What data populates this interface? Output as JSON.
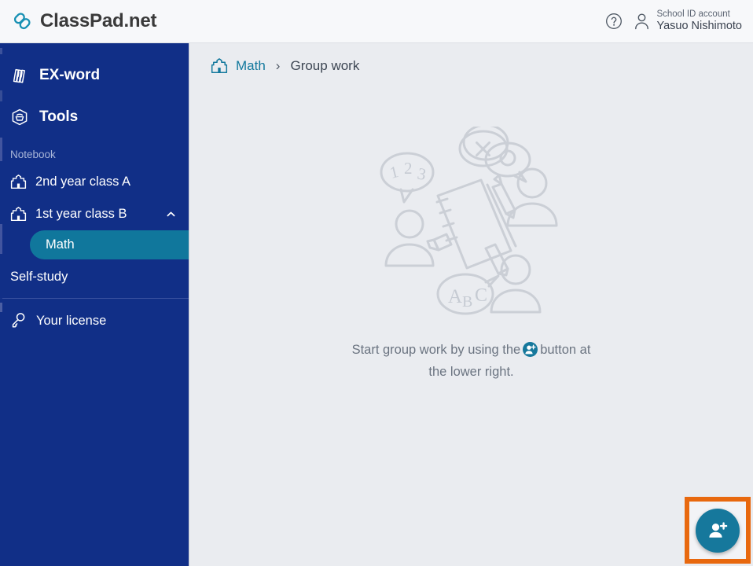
{
  "app": {
    "brand_name": "ClassPad.net",
    "logo_icon": "chain-link-icon",
    "accent_teal": "#16789c",
    "sidebar_navy": "#112f87",
    "annotation_orange": "#e8680e",
    "main_bg": "#eaecf0"
  },
  "topbar": {
    "help_icon": "question-circle-icon",
    "user_icon": "person-icon",
    "account_type": "School ID account",
    "account_name": "Yasuo Nishimoto"
  },
  "sidebar": {
    "top_items": [
      {
        "label": "EX-word",
        "icon": "books-icon"
      },
      {
        "label": "Tools",
        "icon": "toolbox-icon"
      }
    ],
    "section_label": "Notebook",
    "notebooks": [
      {
        "label": "2nd year class A",
        "icon": "classroom-icon",
        "expanded": false
      },
      {
        "label": "1st year class B",
        "icon": "classroom-icon",
        "expanded": true,
        "chevron": "chevron-up-icon"
      }
    ],
    "children": [
      {
        "label": "Math",
        "active": true
      }
    ],
    "self_study_label": "Self-study",
    "bottom_item": {
      "label": "Your license",
      "icon": "key-icon"
    }
  },
  "breadcrumb": {
    "icon": "classroom-icon",
    "parent": "Math",
    "separator": "›",
    "current": "Group work"
  },
  "empty_state": {
    "illustration": "group-work-illustration",
    "bubble_numbers": [
      "1",
      "2",
      "3"
    ],
    "bubble_symbols": [
      "✕",
      "○"
    ],
    "bubble_letters": [
      "A",
      "B",
      "C"
    ],
    "text_before": "Start group work by using the",
    "inline_icon": "add-person-icon",
    "text_after": "button at the lower right."
  },
  "fab": {
    "icon": "add-person-icon",
    "label": "Add group member"
  }
}
